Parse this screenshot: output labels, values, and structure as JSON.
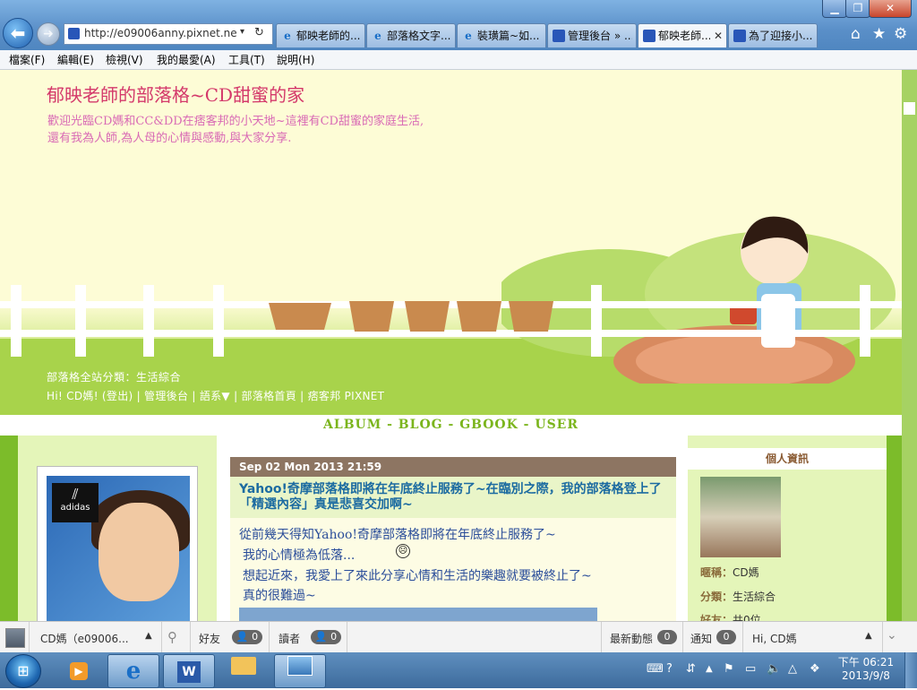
{
  "window": {
    "controls": {
      "minimize": "▁",
      "maximize": "❐",
      "close": "✕"
    }
  },
  "nav": {
    "back": "⬅",
    "forward": "➜"
  },
  "address": {
    "url": "http://e09006anny.pixnet.net/",
    "dropdown": "▾",
    "refresh": "↻"
  },
  "tabs": [
    {
      "label": "郁映老師的...",
      "icon": "ie-icon"
    },
    {
      "label": "部落格文字...",
      "icon": "ie-icon"
    },
    {
      "label": "裝璜篇~如...",
      "icon": "ie-icon"
    },
    {
      "label": "管理後台 » ...",
      "icon": "pixnet-icon"
    },
    {
      "label": "郁映老師...",
      "icon": "pixnet-icon",
      "active": true,
      "close": "✕"
    },
    {
      "label": "為了迎接小...",
      "icon": "pixnet-icon"
    }
  ],
  "toolbar_icons": {
    "home": "⌂",
    "favorites": "★",
    "tools": "⚙"
  },
  "menu": [
    "檔案(F)",
    "編輯(E)",
    "檢視(V)",
    "我的最愛(A)",
    "工具(T)",
    "說明(H)"
  ],
  "blog": {
    "title": "郁映老師的部落格~CD甜蜜的家",
    "desc1": "歡迎光臨CD媽和CC&DD在痞客邦的小天地~這裡有CD甜蜜的家庭生活,",
    "desc2": "還有我為人師,為人母的心情與感動,與大家分享.",
    "category": "部落格全站分類：生活綜合",
    "userlinks": "Hi! CD媽! (登出) | 管理後台 | 語系▼ | 部落格首頁 | 痞客邦 PIXNET",
    "nav": "ALBUM - BLOG - GBOOK - USER"
  },
  "sidebar_left": {
    "photo_brand": "adidas"
  },
  "post": {
    "date": "Sep 02 Mon 2013 21:59",
    "title": "Yahoo!奇摩部落格即將在年底終止服務了~在臨別之際，我的部落格登上了「精選內容」真是悲喜交加啊~",
    "lines": [
      "從前幾天得知Yahoo!奇摩部落格即將在年底終止服務了~",
      "我的心情極為低落...",
      "想起近來，我愛上了來此分享心情和生活的樂趣就要被終止了~",
      "真的很難過~"
    ],
    "emoticon": "☹"
  },
  "sidebar_right": {
    "heading": "個人資訊",
    "nickname_label": "暱稱：",
    "nickname": "CD媽",
    "category_label": "分類：",
    "category": "生活綜合",
    "friends_label": "好友：",
    "friends": "共0位"
  },
  "pixbar": {
    "user": "CD媽（e09006...",
    "friends_label": "好友",
    "friends_count": "0",
    "readers_label": "讀者",
    "readers_count": "0",
    "activity_label": "最新動態",
    "activity_count": "0",
    "notify_label": "通知",
    "notify_count": "0",
    "greeting": "Hi, CD媽"
  },
  "taskbar": {
    "apps": [
      "media-player-icon",
      "internet-explorer-icon",
      "word-icon",
      "file-explorer-icon",
      "photo-viewer-icon"
    ],
    "clock_time": "下午 06:21",
    "clock_date": "2013/9/8"
  }
}
